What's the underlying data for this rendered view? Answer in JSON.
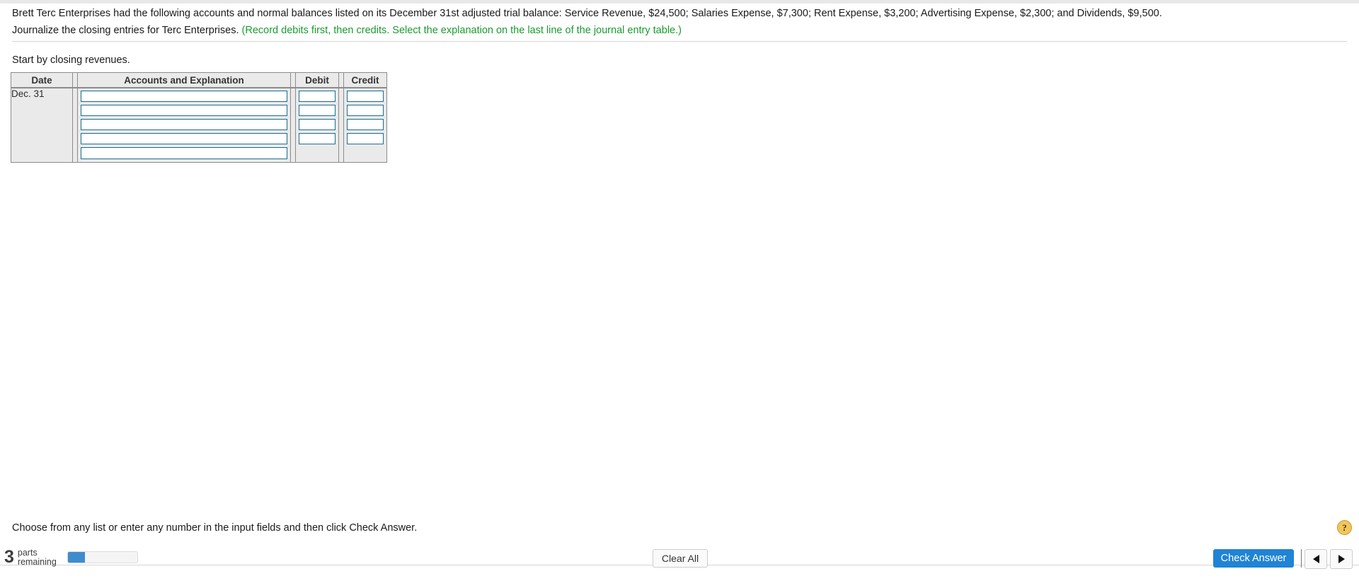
{
  "problem": {
    "statement": "Brett Terc Enterprises had the following accounts and normal balances listed on its December 31st adjusted trial balance: Service Revenue, $24,500; Salaries Expense, $7,300; Rent Expense, $3,200; Advertising Expense, $2,300; and Dividends, $9,500.",
    "instruction": "Journalize the closing entries for Terc Enterprises.",
    "instruction_note": "(Record debits first, then credits. Select the explanation on the last line of the journal entry table.)",
    "sub_prompt": "Start by closing revenues."
  },
  "journal": {
    "headers": {
      "date": "Date",
      "accounts": "Accounts and Explanation",
      "debit": "Debit",
      "credit": "Credit"
    },
    "date_value": "Dec. 31",
    "rows": [
      {
        "account": "",
        "debit": "",
        "credit": "",
        "has_amounts": true
      },
      {
        "account": "",
        "debit": "",
        "credit": "",
        "has_amounts": true
      },
      {
        "account": "",
        "debit": "",
        "credit": "",
        "has_amounts": true
      },
      {
        "account": "",
        "debit": "",
        "credit": "",
        "has_amounts": true
      },
      {
        "account": "",
        "debit": "",
        "credit": "",
        "has_amounts": false
      }
    ]
  },
  "footer": {
    "hint": "Choose from any list or enter any number in the input fields and then click Check Answer.",
    "help_icon": "question-mark-help-icon",
    "parts_count": "3",
    "parts_label_line1": "parts",
    "parts_label_line2": "remaining",
    "progress_percent": 25,
    "clear_all_label": "Clear All",
    "check_answer_label": "Check Answer",
    "prev_icon": "triangle-left-icon",
    "next_icon": "triangle-right-icon"
  },
  "colors": {
    "accent_blue": "#2083d5",
    "progress_blue": "#3e8ccc",
    "note_green": "#1a9c2f",
    "input_border": "#1a6f96",
    "table_bg": "#eaeaea",
    "help_gold": "#f1c75c"
  }
}
